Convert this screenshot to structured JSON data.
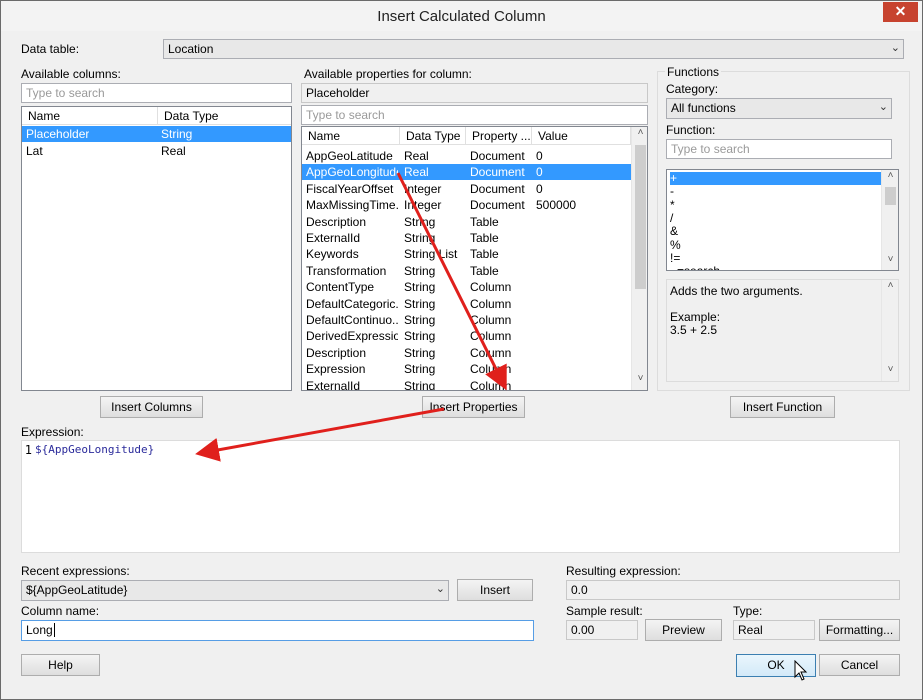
{
  "window": {
    "title": "Insert Calculated Column",
    "close_glyph": "✕"
  },
  "data_table": {
    "label": "Data table:",
    "value": "Location"
  },
  "available_columns": {
    "label": "Available columns:",
    "search_placeholder": "Type to search",
    "headers": [
      "Name",
      "Data Type"
    ],
    "rows": [
      {
        "name": "Placeholder",
        "type": "String",
        "selected": true
      },
      {
        "name": "Lat",
        "type": "Real",
        "selected": false
      }
    ],
    "insert_button": "Insert Columns"
  },
  "available_properties": {
    "label": "Available properties for column:",
    "column_value": "Placeholder",
    "search_placeholder": "Type to search",
    "headers": [
      "Name",
      "Data Type",
      "Property ...",
      "Value"
    ],
    "rows": [
      {
        "name": "AppGeoLatitude",
        "type": "Real",
        "prop": "Document",
        "value": "0"
      },
      {
        "name": "AppGeoLongitude",
        "type": "Real",
        "prop": "Document",
        "value": "0"
      },
      {
        "name": "FiscalYearOffset",
        "type": "Integer",
        "prop": "Document",
        "value": "0"
      },
      {
        "name": "MaxMissingTime...",
        "type": "Integer",
        "prop": "Document",
        "value": "500000"
      },
      {
        "name": "Description",
        "type": "String",
        "prop": "Table",
        "value": ""
      },
      {
        "name": "ExternalId",
        "type": "String",
        "prop": "Table",
        "value": ""
      },
      {
        "name": "Keywords",
        "type": "String List",
        "prop": "Table",
        "value": ""
      },
      {
        "name": "Transformation",
        "type": "String",
        "prop": "Table",
        "value": ""
      },
      {
        "name": "ContentType",
        "type": "String",
        "prop": "Column",
        "value": ""
      },
      {
        "name": "DefaultCategoric...",
        "type": "String",
        "prop": "Column",
        "value": ""
      },
      {
        "name": "DefaultContinuo...",
        "type": "String",
        "prop": "Column",
        "value": ""
      },
      {
        "name": "DerivedExpression",
        "type": "String",
        "prop": "Column",
        "value": ""
      },
      {
        "name": "Description",
        "type": "String",
        "prop": "Column",
        "value": ""
      },
      {
        "name": "Expression",
        "type": "String",
        "prop": "Column",
        "value": ""
      },
      {
        "name": "ExternalId",
        "type": "String",
        "prop": "Column",
        "value": ""
      }
    ],
    "selected_row": "AppGeoLongitude",
    "insert_button": "Insert Properties"
  },
  "functions": {
    "group_label": "Functions",
    "category_label": "Category:",
    "category_value": "All functions",
    "function_label": "Function:",
    "search_placeholder": "Type to search",
    "items": [
      "+",
      "-",
      "*",
      "/",
      "&",
      "%",
      "!=",
      "~=search"
    ],
    "selected_item": "+",
    "description": "Adds the two arguments.",
    "example_label": "Example:",
    "example_value": "3.5 + 2.5",
    "insert_button": "Insert Function"
  },
  "expression": {
    "label": "Expression:",
    "line_number": "1",
    "text": "${AppGeoLongitude}"
  },
  "recent_expressions": {
    "label": "Recent expressions:",
    "value": "${AppGeoLatitude}",
    "insert_button": "Insert"
  },
  "column_name": {
    "label": "Column name:",
    "value": "Long"
  },
  "resulting_expression": {
    "label": "Resulting expression:",
    "value": "0.0"
  },
  "sample_result": {
    "label": "Sample result:",
    "value": "0.00",
    "preview_button": "Preview"
  },
  "type": {
    "label": "Type:",
    "value": "Real",
    "formatting_button": "Formatting..."
  },
  "footer": {
    "help_button": "Help",
    "ok_button": "OK",
    "cancel_button": "Cancel"
  },
  "icons": {
    "dropdown": "chevron-down-icon",
    "scroll_up": "chevron-up-icon",
    "scroll_down": "chevron-down-icon",
    "annotation_arrow": "red-arrow"
  },
  "colors": {
    "selection": "#3399ff",
    "arrow": "#e0201c",
    "close": "#c7432f"
  }
}
